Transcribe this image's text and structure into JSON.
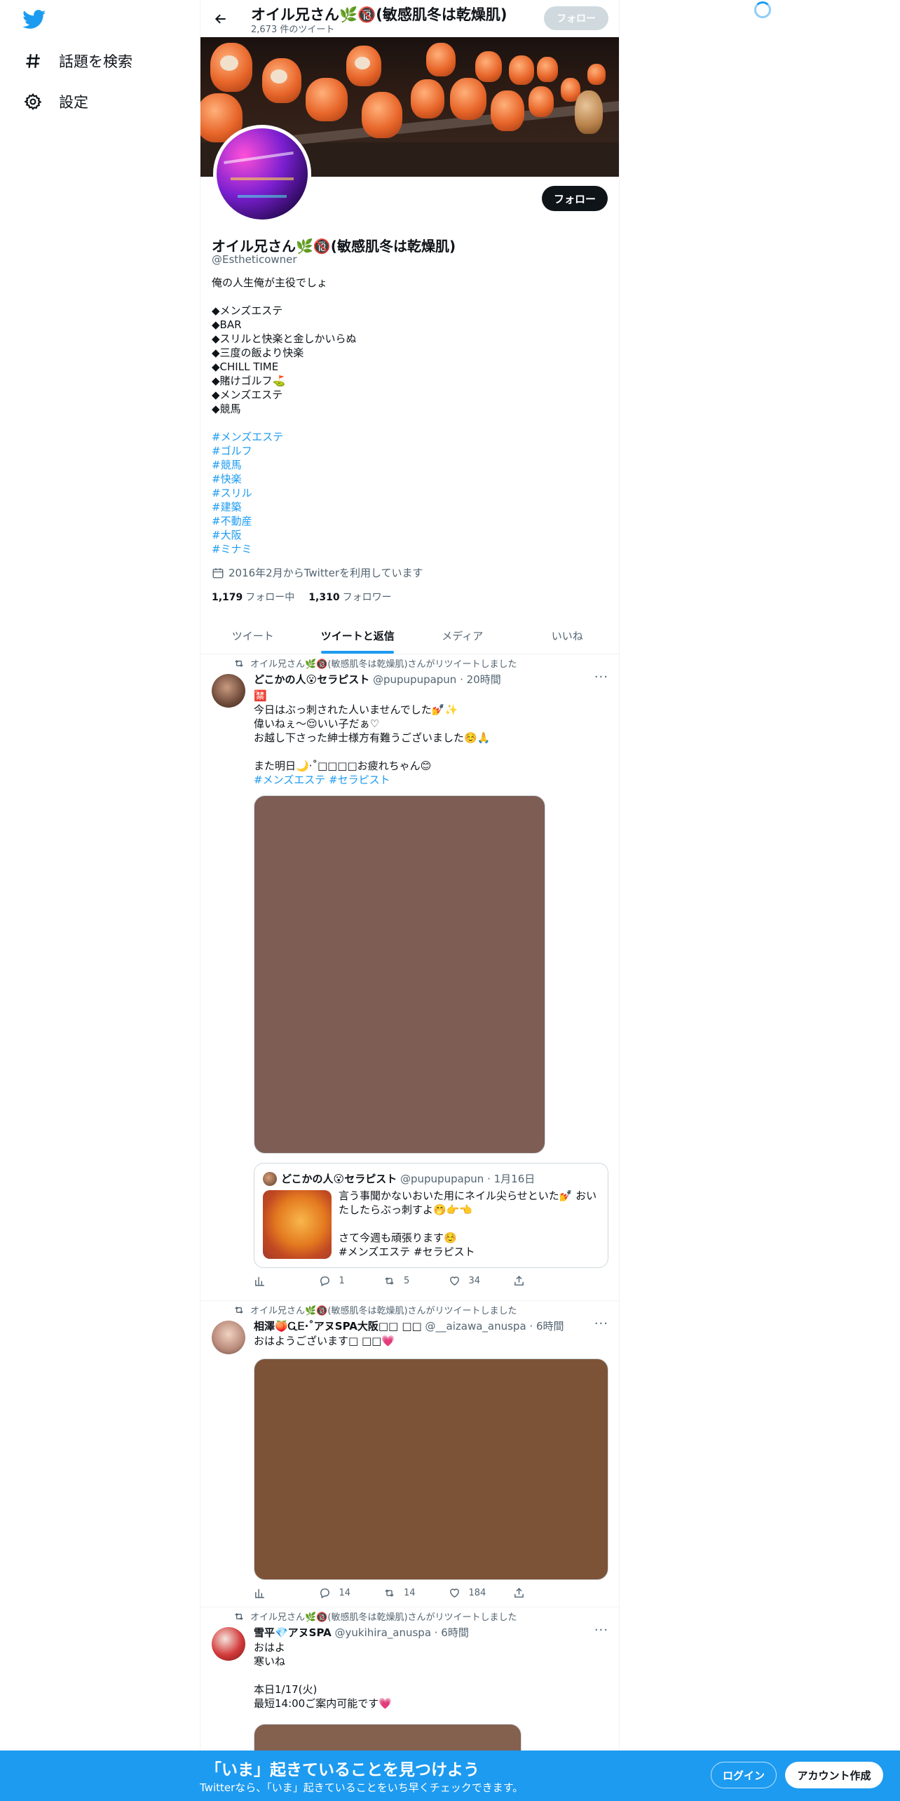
{
  "nav": {
    "explore_label": "話題を検索",
    "settings_label": "設定"
  },
  "header": {
    "title": "オイル兄さん🌿🔞(敏感肌冬は乾燥肌)",
    "subtitle": "2,673 件のツイート",
    "follow_label": "フォロー"
  },
  "profile": {
    "name": "オイル兄さん🌿🔞(敏感肌冬は乾燥肌)",
    "handle": "@Estheticowner",
    "follow_label": "フォロー",
    "bio": {
      "l1": "俺の人生俺が主役でしょ",
      "l2": "◆メンズエステ",
      "l3": "◆BAR",
      "l4": "◆スリルと快楽と金しかいらぬ",
      "l5": "◆三度の飯より快楽",
      "l6": "◆CHILL TIME",
      "l7": "◆賭けゴルフ⛳",
      "l8": "◆メンズエステ",
      "l9": "◆競馬"
    },
    "hashtags": {
      "h1": "#メンズエステ",
      "h2": "#ゴルフ",
      "h3": "#競馬",
      "h4": "#快楽",
      "h5": "#スリル",
      "h6": "#建築",
      "h7": "#不動産",
      "h8": "#大阪",
      "h9": "#ミナミ"
    },
    "joined": "2016年2月からTwitterを利用しています",
    "following_count": "1,179",
    "following_label": "フォロー中",
    "followers_count": "1,310",
    "followers_label": "フォロワー"
  },
  "tabs": {
    "t1": "ツイート",
    "t2": "ツイートと返信",
    "t3": "メディア",
    "t4": "いいね"
  },
  "tweets": {
    "t1": {
      "retweet_line": "オイル兄さん🌿🔞(敏感肌冬は乾燥肌)さんがリツイートしました",
      "name": "どこかの人😮セラピスト",
      "meta": "@pupupupapun · 20時間",
      "body": {
        "l1": "🈲",
        "l2": "今日はぶっ刺された人いませんでした💅✨",
        "l3": "偉いねぇ～😌いい子だぁ♡",
        "l4": "お越し下さった紳士様方有難うございました☺️🙏",
        "l5": "",
        "l6": "また明日🌙·˚□□□□お疲れちゃん😊",
        "l7": "#メンズエステ #セラピスト"
      },
      "quote": {
        "name": "どこかの人😮セラピスト",
        "meta": "@pupupupapun · 1月16日",
        "l1": "言う事聞かないおいた用にネイル尖らせといた💅 おいたしたらぶっ刺すよ🤭👉👈",
        "l2": "",
        "l3": "さて今週も頑張ります☺️",
        "l4": "#メンズエステ #セラピスト"
      },
      "replies": "1",
      "retweets": "5",
      "likes": "34"
    },
    "t2": {
      "retweet_line": "オイル兄さん🌿🔞(敏感肌冬は乾燥肌)さんがリツイートしました",
      "name": "相澤🍑ᏩᎬ·˚アヌSPA大阪□□ □□",
      "meta": "@__aizawa_anuspa · 6時間",
      "body": {
        "l1": "おはようございます□ □□💗"
      },
      "replies": "14",
      "retweets": "14",
      "likes": "184"
    },
    "t3": {
      "retweet_line": "オイル兄さん🌿🔞(敏感肌冬は乾燥肌)さんがリツイートしました",
      "name": "雪平💎アヌSPA",
      "meta": "@yukihira_anuspa · 6時間",
      "body": {
        "l1": "おはよ",
        "l2": "寒いね",
        "l3": "",
        "l4": "本日1/17(火)",
        "l5": "最短14:00ご案内可能です💗"
      }
    }
  },
  "bottom_bar": {
    "title": "「いま」起きていることを見つけよう",
    "subtitle": "Twitterなら、「いま」起きていることをいち早くチェックできます。",
    "login_label": "ログイン",
    "signup_label": "アカウント作成"
  },
  "colors": {
    "accent": "#1d9bf0",
    "text": "#0f1419",
    "secondary": "#536471",
    "media1": "#7e5d55",
    "media2": "#7d5337",
    "media3": "#84604f"
  }
}
